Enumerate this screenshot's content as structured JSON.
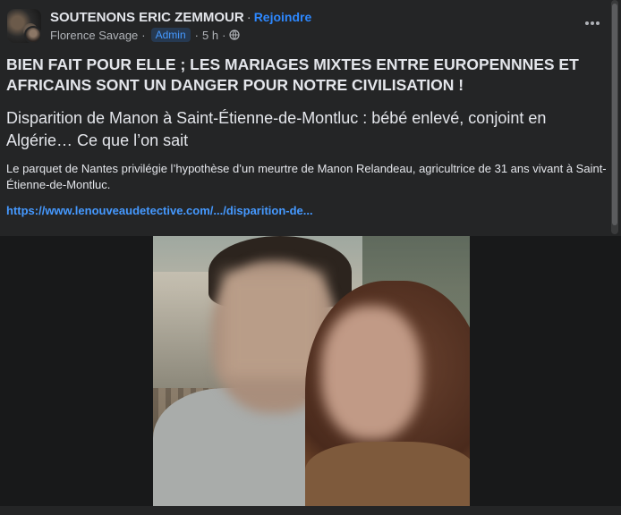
{
  "header": {
    "group_name": "SOUTENONS ERIC ZEMMOUR",
    "dot": "·",
    "join_label": "Rejoindre",
    "author": "Florence Savage",
    "author_sep": "·",
    "badge": "Admin",
    "time_sep": "·",
    "time": "5 h",
    "time_suffix": "·"
  },
  "post": {
    "headline": "BIEN FAIT POUR ELLE ; LES MARIAGES MIXTES ENTRE EUROPENNNES ET AFRICAINS SONT UN DANGER POUR NOTRE CIVILISATION !"
  },
  "link_preview": {
    "title": "Disparition de Manon à Saint-Étienne-de-Montluc : bébé enlevé, conjoint en Algérie… Ce que l’on sait",
    "description": "Le parquet de Nantes privilégie l’hypothèse d’un meurtre de Manon Relandeau, agricultrice de 31 ans vivant à Saint-Étienne-de-Montluc.",
    "url": "https://www.lenouveaudetective.com/.../disparition-de..."
  },
  "icons": {
    "more": "more-options-icon",
    "globe": "globe-icon"
  },
  "colors": {
    "background": "#242526",
    "link": "#4599ff",
    "text": "#e4e6eb",
    "secondary": "#b0b3b8"
  }
}
